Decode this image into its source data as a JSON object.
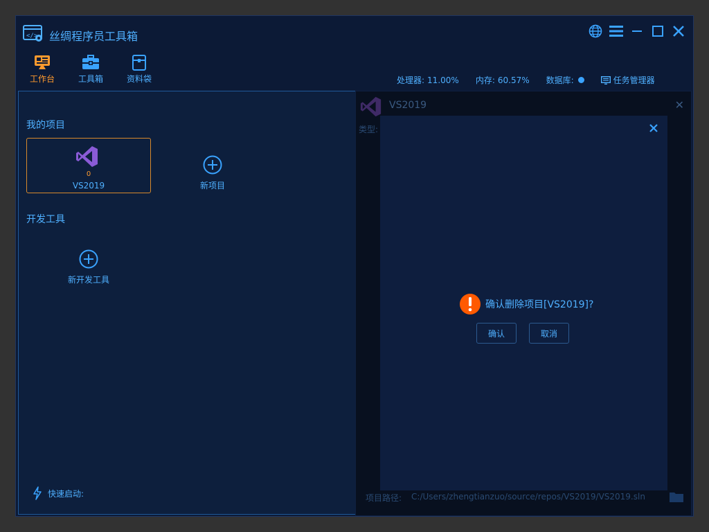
{
  "app": {
    "title": "丝绸程序员工具箱"
  },
  "window_buttons": [
    "globe-icon",
    "menu-icon",
    "minimize-icon",
    "maximize-icon",
    "close-icon"
  ],
  "nav": [
    {
      "label": "工作台",
      "icon": "workbench-icon",
      "active": true
    },
    {
      "label": "工具箱",
      "icon": "toolbox-icon",
      "active": false
    },
    {
      "label": "资料袋",
      "icon": "briefcase-icon",
      "active": false
    }
  ],
  "stats": {
    "cpu_label": "处理器:",
    "cpu_value": "11.00%",
    "mem_label": "内存:",
    "mem_value": "60.57%",
    "db_label": "数据库:",
    "task_manager": "任务管理器"
  },
  "projects": {
    "section_title": "我的项目",
    "items": [
      {
        "name": "VS2019",
        "count": "0"
      }
    ],
    "add_label": "新项目"
  },
  "dev_tools": {
    "section_title": "开发工具",
    "add_label": "新开发工具"
  },
  "quick_launch": {
    "label": "快速启动:"
  },
  "detail": {
    "title": "VS2019",
    "type_label": "类型:",
    "path_label": "项目路径:",
    "path_value": "C:/Users/zhengtianzuo/source/repos/VS2019/VS2019.sln"
  },
  "dialog": {
    "message": "确认删除项目[VS2019]?",
    "confirm": "确认",
    "cancel": "取消"
  },
  "colors": {
    "accent": "#3aa3ff",
    "active": "#ff9a2e",
    "warning": "#ff5a00",
    "background": "#0c1a36"
  }
}
